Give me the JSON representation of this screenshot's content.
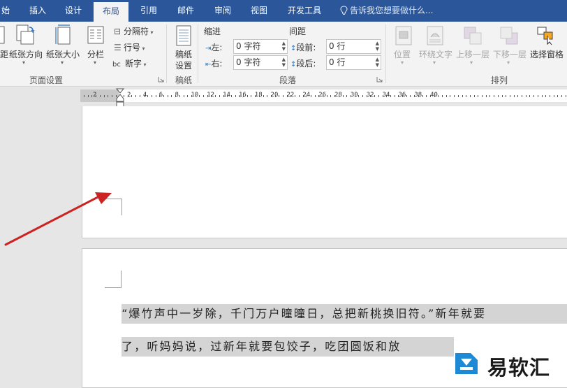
{
  "tabs": [
    {
      "label": "始",
      "active": false
    },
    {
      "label": "插入",
      "active": false
    },
    {
      "label": "设计",
      "active": false
    },
    {
      "label": "布局",
      "active": true
    },
    {
      "label": "引用",
      "active": false
    },
    {
      "label": "邮件",
      "active": false
    },
    {
      "label": "审阅",
      "active": false
    },
    {
      "label": "视图",
      "active": false
    },
    {
      "label": "开发工具",
      "active": false
    }
  ],
  "tell_me": "告诉我您想要做什么...",
  "ribbon": {
    "page_setup": {
      "margins_label": "距",
      "orientation_label": "纸张方向",
      "size_label": "纸张大小",
      "columns_label": "分栏",
      "breaks_label": "分隔符",
      "line_numbers_label": "行号",
      "hyphenation_label": "断字",
      "group_label": "页面设置"
    },
    "draft_paper": {
      "line1": "稿纸",
      "line2": "设置",
      "group_label": "稿纸"
    },
    "paragraph": {
      "indent_header": "缩进",
      "spacing_header": "间距",
      "left_label": "左:",
      "left_value": "0 字符",
      "right_label": "右:",
      "right_value": "0 字符",
      "before_label": "段前:",
      "before_value": "0 行",
      "after_label": "段后:",
      "after_value": "0 行",
      "group_label": "段落"
    },
    "arrange": {
      "position_label": "位置",
      "wrap_text_label": "环绕文字",
      "bring_forward_label": "上移一层",
      "send_backward_label": "下移一层",
      "selection_pane_label": "选择窗格",
      "group_label": "排列"
    }
  },
  "ruler": {
    "numbers": [
      "2",
      "2",
      "4",
      "6",
      "8",
      "10",
      "12",
      "14",
      "16",
      "18",
      "20",
      "22",
      "24",
      "26",
      "28",
      "30",
      "32",
      "34",
      "36",
      "38",
      "40"
    ]
  },
  "document": {
    "line1": "“爆竹声中一岁除，千门万户曈曈日，总把新桃换旧符。”新年就要",
    "line2": "了，听妈妈说，过新年就要包饺子，吃团圆饭和放"
  },
  "watermark": {
    "text": "易软汇"
  },
  "colors": {
    "tab_bar": "#2b579a",
    "arrow": "#cc2222",
    "selection": "#d4d4d4"
  }
}
